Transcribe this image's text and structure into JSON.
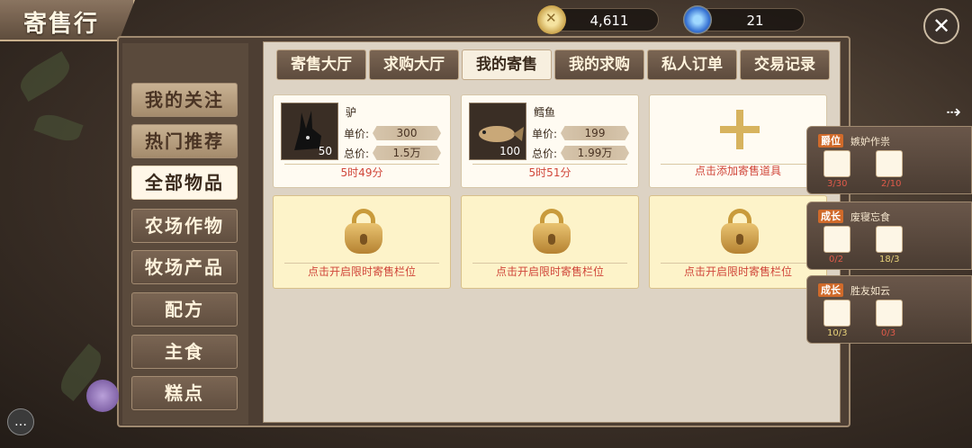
{
  "title": "寄售行",
  "currency": [
    {
      "icon": "gold-coin-icon",
      "value": "4,611"
    },
    {
      "icon": "blue-gem-icon",
      "value": "21"
    }
  ],
  "sidebar": {
    "items": [
      {
        "label": "我的关注",
        "state": "fav"
      },
      {
        "label": "热门推荐",
        "state": "fav"
      },
      {
        "label": "全部物品",
        "state": "selected"
      },
      {
        "label": "农场作物",
        "state": "normal"
      },
      {
        "label": "牧场产品",
        "state": "normal"
      },
      {
        "label": "配方",
        "state": "normal"
      },
      {
        "label": "主食",
        "state": "normal"
      },
      {
        "label": "糕点",
        "state": "normal"
      }
    ]
  },
  "tabs": [
    {
      "label": "寄售大厅",
      "selected": false
    },
    {
      "label": "求购大厅",
      "selected": false
    },
    {
      "label": "我的寄售",
      "selected": true
    },
    {
      "label": "我的求购",
      "selected": false
    },
    {
      "label": "私人订单",
      "selected": false
    },
    {
      "label": "交易记录",
      "selected": false
    }
  ],
  "listings": [
    {
      "name": "驴",
      "qty": "50",
      "unit_label": "单价:",
      "unit_price": "300",
      "total_label": "总价:",
      "total_price": "1.5万",
      "time": "5时49分",
      "icon": "donkey-icon"
    },
    {
      "name": "鳕鱼",
      "qty": "100",
      "unit_label": "单价:",
      "unit_price": "199",
      "total_label": "总价:",
      "total_price": "1.99万",
      "time": "5时51分",
      "icon": "cod-fish-icon"
    }
  ],
  "add_slot": {
    "text": "点击添加寄售道具"
  },
  "locked_slots": [
    {
      "text": "点击开启限时寄售栏位"
    },
    {
      "text": "点击开启限时寄售栏位"
    },
    {
      "text": "点击开启限时寄售栏位"
    }
  ],
  "quests": [
    {
      "tag": "爵位",
      "title": "嫉妒作祟",
      "items": [
        {
          "icon": "bread-icon",
          "count": "3/30",
          "color": "#e05a4a"
        },
        {
          "icon": "drink-icon",
          "count": "2/10",
          "color": "#e05a4a"
        }
      ]
    },
    {
      "tag": "成长",
      "title": "废寝忘食",
      "items": [
        {
          "icon": "chocolate-icon",
          "count": "0/2",
          "color": "#e05a4a"
        },
        {
          "icon": "pie-icon",
          "count": "18/3",
          "color": "#e8d27a"
        }
      ]
    },
    {
      "tag": "成长",
      "title": "胜友如云",
      "items": [
        {
          "icon": "burger-icon",
          "count": "10/3",
          "color": "#e8d27a"
        },
        {
          "icon": "chocolate-icon",
          "count": "0/3",
          "color": "#e05a4a"
        }
      ]
    }
  ],
  "icons": {
    "close": "close-x-icon",
    "exit": "arrow-exit-icon",
    "chat": "chat-bubble-icon"
  }
}
